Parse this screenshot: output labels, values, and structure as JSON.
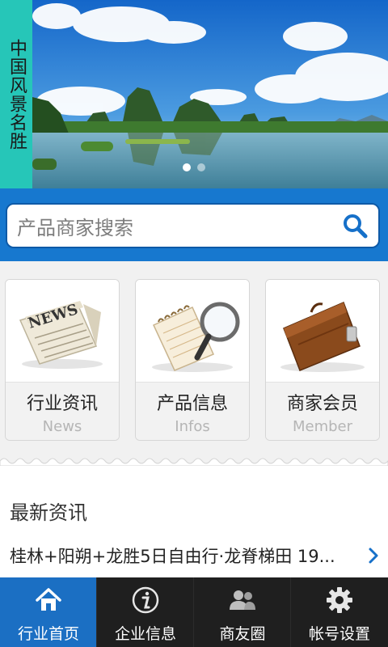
{
  "banner": {
    "label": "中国风景名胜",
    "dots": 2,
    "active_dot": 1
  },
  "search": {
    "placeholder": "产品商家搜索"
  },
  "categories": [
    {
      "title": "行业资讯",
      "subtitle": "News",
      "icon": "newspaper-icon"
    },
    {
      "title": "产品信息",
      "subtitle": "Infos",
      "icon": "notepad-magnifier-icon"
    },
    {
      "title": "商家会员",
      "subtitle": "Member",
      "icon": "briefcase-icon"
    }
  ],
  "news": {
    "heading": "最新资讯",
    "items": [
      {
        "text": "桂林+阳朔+龙胜5日自由行·龙脊梯田 19..."
      }
    ]
  },
  "nav": {
    "items": [
      {
        "label": "行业首页",
        "icon": "home-icon",
        "active": true
      },
      {
        "label": "企业信息",
        "icon": "info-icon",
        "active": false
      },
      {
        "label": "商友圈",
        "icon": "users-icon",
        "active": false
      },
      {
        "label": "帐号设置",
        "icon": "gear-icon",
        "active": false
      }
    ]
  },
  "colors": {
    "teal_label": "#26c6b8",
    "brand_blue": "#1778cf",
    "nav_active": "#1b6fc3",
    "nav_bg": "#1f1f1f"
  }
}
